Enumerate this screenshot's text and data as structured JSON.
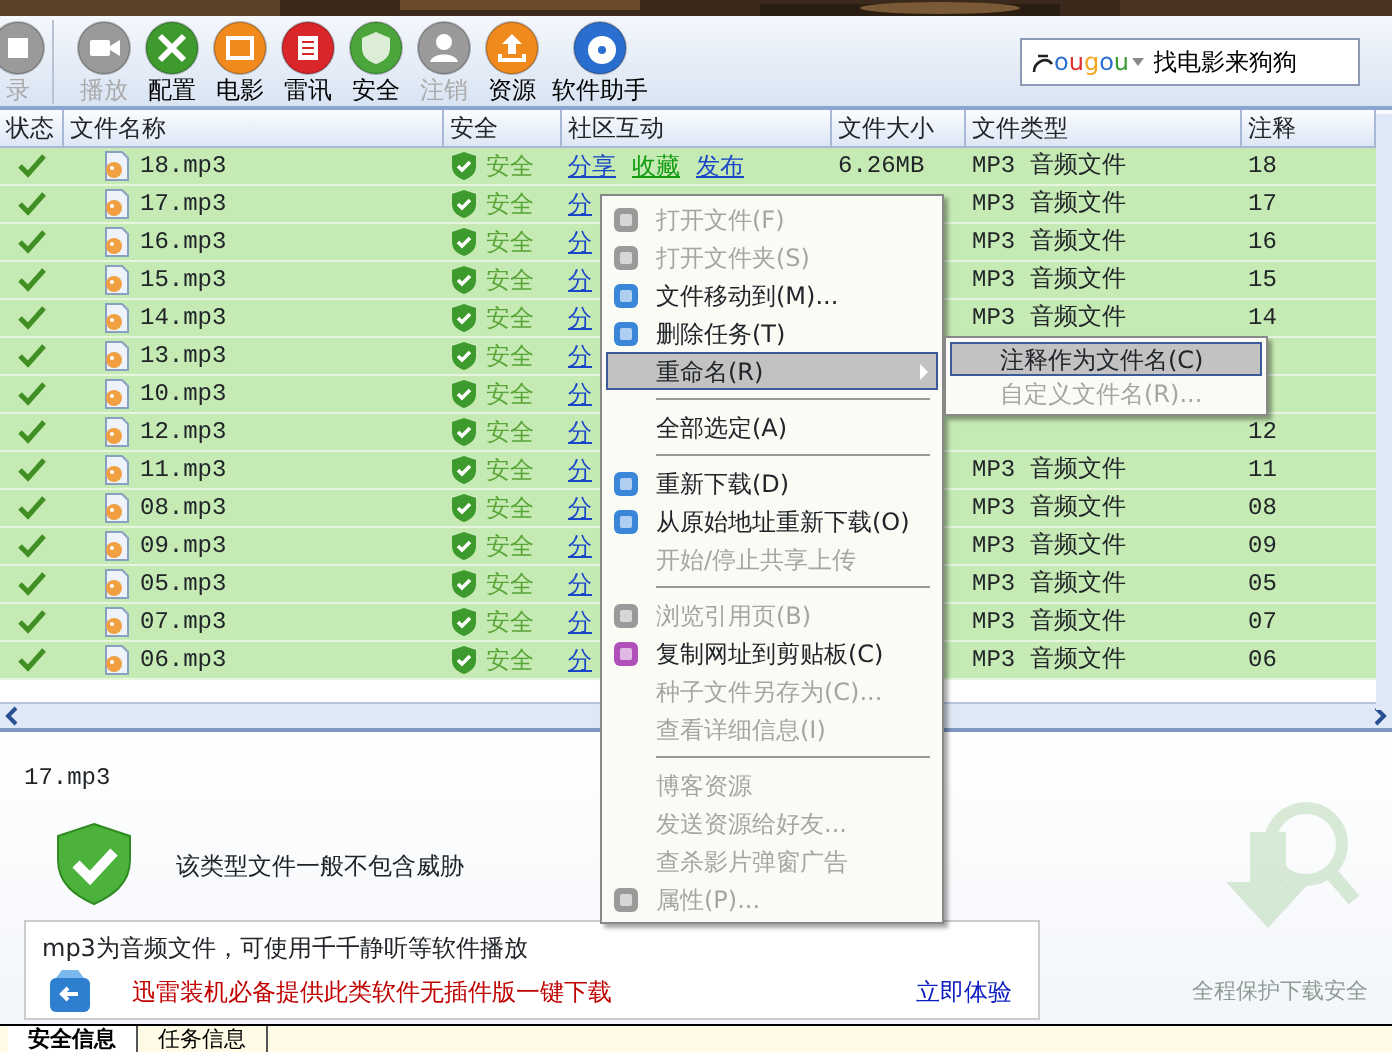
{
  "toolbar": {
    "buttons": [
      {
        "label": "录",
        "disabled": true,
        "color": "#9a9a9a"
      },
      {
        "label": "播放",
        "disabled": true,
        "color": "#9a9a9a"
      },
      {
        "label": "配置",
        "disabled": false,
        "color": "#3f9a2e"
      },
      {
        "label": "电影",
        "disabled": false,
        "color": "#f08a1c"
      },
      {
        "label": "雷讯",
        "disabled": false,
        "color": "#d8262b"
      },
      {
        "label": "安全",
        "disabled": false,
        "color": "#4aa53a"
      },
      {
        "label": "注销",
        "disabled": true,
        "color": "#9a9a9a"
      },
      {
        "label": "资源",
        "disabled": false,
        "color": "#f08a1c"
      },
      {
        "label": "软件助手",
        "disabled": false,
        "color": "#2a6fd0"
      }
    ],
    "search": {
      "engine": "ougou",
      "placeholder": "找电影来狗狗"
    }
  },
  "table": {
    "columns": [
      "状态",
      "文件名称",
      "安全",
      "社区互动",
      "文件大小",
      "文件类型",
      "注释"
    ],
    "rows": [
      {
        "done": true,
        "name": "18.mp3",
        "security": "安全",
        "community": [
          "分享",
          "收藏",
          "发布"
        ],
        "size": "6.26MB",
        "type": "MP3 音频文件",
        "note": "18"
      },
      {
        "done": true,
        "name": "17.mp3",
        "security": "安全",
        "community": [
          "分"
        ],
        "type": "MP3 音频文件",
        "note": "17"
      },
      {
        "done": true,
        "name": "16.mp3",
        "security": "安全",
        "community": [
          "分"
        ],
        "type": "MP3 音频文件",
        "note": "16"
      },
      {
        "done": true,
        "name": "15.mp3",
        "security": "安全",
        "community": [
          "分"
        ],
        "type": "MP3 音频文件",
        "note": "15"
      },
      {
        "done": true,
        "name": "14.mp3",
        "security": "安全",
        "community": [
          "分"
        ],
        "type": "MP3 音频文件",
        "note": "14"
      },
      {
        "done": true,
        "name": "13.mp3",
        "security": "安全",
        "community": [
          "分"
        ]
      },
      {
        "done": true,
        "name": "10.mp3",
        "security": "安全",
        "community": [
          "分"
        ]
      },
      {
        "done": true,
        "name": "12.mp3",
        "security": "安全",
        "community": [
          "分"
        ],
        "note": "12"
      },
      {
        "done": true,
        "name": "11.mp3",
        "security": "安全",
        "community": [
          "分"
        ],
        "type": "MP3 音频文件",
        "note": "11"
      },
      {
        "done": true,
        "name": "08.mp3",
        "security": "安全",
        "community": [
          "分"
        ],
        "type": "MP3 音频文件",
        "note": "08"
      },
      {
        "done": true,
        "name": "09.mp3",
        "security": "安全",
        "community": [
          "分"
        ],
        "type": "MP3 音频文件",
        "note": "09"
      },
      {
        "done": true,
        "name": "05.mp3",
        "security": "安全",
        "community": [
          "分"
        ],
        "type": "MP3 音频文件",
        "note": "05"
      },
      {
        "done": true,
        "name": "07.mp3",
        "security": "安全",
        "community": [
          "分"
        ],
        "type": "MP3 音频文件",
        "note": "07"
      },
      {
        "done": true,
        "name": "06.mp3",
        "security": "安全",
        "community": [
          "分"
        ],
        "type": "MP3 音频文件",
        "note": "06"
      }
    ]
  },
  "context_menu": {
    "items": [
      {
        "kind": "item",
        "label": "打开文件(F)",
        "disabled": true,
        "icon": true,
        "selected": false
      },
      {
        "kind": "item",
        "label": "打开文件夹(S)",
        "disabled": true,
        "icon": true,
        "selected": false
      },
      {
        "kind": "item",
        "label": "文件移动到(M)...",
        "disabled": false,
        "icon": true,
        "selected": false
      },
      {
        "kind": "item",
        "label": "删除任务(T)",
        "disabled": false,
        "icon": true,
        "selected": false
      },
      {
        "kind": "submenu",
        "label": "重命名(R)",
        "disabled": false,
        "icon": false,
        "selected": true
      },
      {
        "kind": "separator"
      },
      {
        "kind": "item",
        "label": "全部选定(A)",
        "disabled": false,
        "icon": false,
        "selected": false
      },
      {
        "kind": "separator"
      },
      {
        "kind": "item",
        "label": "重新下载(D)",
        "disabled": false,
        "icon": true,
        "selected": false
      },
      {
        "kind": "item",
        "label": "从原始地址重新下载(O)",
        "disabled": false,
        "icon": true,
        "selected": false
      },
      {
        "kind": "item",
        "label": "开始/停止共享上传",
        "disabled": true,
        "icon": false,
        "selected": false
      },
      {
        "kind": "separator"
      },
      {
        "kind": "item",
        "label": "浏览引用页(B)",
        "disabled": true,
        "icon": true,
        "selected": false
      },
      {
        "kind": "item",
        "label": "复制网址到剪贴板(C)",
        "disabled": false,
        "icon": true,
        "selected": false
      },
      {
        "kind": "item",
        "label": "种子文件另存为(C)...",
        "disabled": true,
        "icon": false,
        "selected": false
      },
      {
        "kind": "item",
        "label": "查看详细信息(I)",
        "disabled": true,
        "icon": false,
        "selected": false
      },
      {
        "kind": "separator"
      },
      {
        "kind": "item",
        "label": "博客资源",
        "disabled": true,
        "icon": false,
        "selected": false
      },
      {
        "kind": "item",
        "label": "发送资源给好友...",
        "disabled": true,
        "icon": false,
        "selected": false
      },
      {
        "kind": "item",
        "label": "查杀影片弹窗广告",
        "disabled": true,
        "icon": false,
        "selected": false
      },
      {
        "kind": "item",
        "label": "属性(P)...",
        "disabled": true,
        "icon": true,
        "selected": false
      }
    ],
    "submenu": [
      {
        "label": "注释作为文件名(C)",
        "disabled": false,
        "selected": true
      },
      {
        "label": "自定义文件名(R)...",
        "disabled": true,
        "selected": false
      }
    ]
  },
  "detail": {
    "file": "17.mp3",
    "verdict": "该类型文件一般不包含威胁",
    "info": "mp3为音频文件，可使用千千静听等软件播放",
    "promo": "迅雷装机必备提供此类软件无插件版一键下载",
    "promo_link": "立即体验",
    "background_text": "全程保护下载安全"
  },
  "bottom_tabs": [
    {
      "label": "安全信息",
      "selected": true
    },
    {
      "label": "任务信息",
      "selected": false
    }
  ]
}
